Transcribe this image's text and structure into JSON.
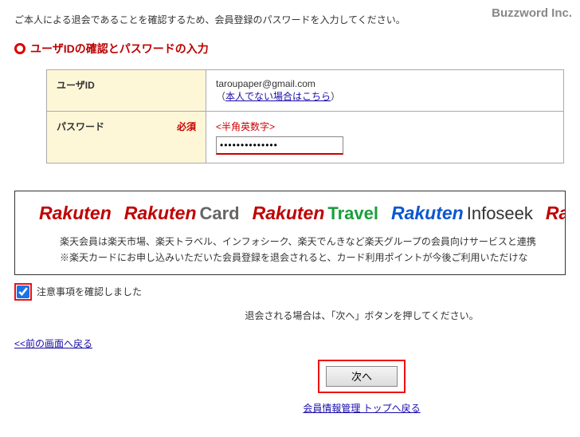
{
  "brand": "Buzzword Inc.",
  "intro": "ご本人による退会であることを確認するため、会員登録のパスワードを入力してください。",
  "section_title": "ユーザIDの確認とパスワードの入力",
  "form": {
    "userid_label": "ユーザID",
    "userid_value": "taroupaper@gmail.com",
    "userid_sublink_open": "（",
    "userid_sublink": "本人でない場合はこちら",
    "userid_sublink_close": "）",
    "password_label": "パスワード",
    "required": "必須",
    "password_hint": "<半角英数字>",
    "password_value": "••••••••••••••"
  },
  "logos": {
    "l1": "Rakuten",
    "l2": "Rakuten",
    "l2sub": "Card",
    "l3": "Rakuten",
    "l3sub": "Travel",
    "l4": "Rakuten",
    "l4sub": "Infoseek",
    "l5": "Ra"
  },
  "banner": {
    "line1": "楽天会員は楽天市場、楽天トラベル、インフォシーク、楽天でんきなど楽天グループの会員向けサービスと連携",
    "line2": "※楽天カードにお申し込みいただいた会員登録を退会されると、カード利用ポイントが今後ご利用いただけな"
  },
  "confirm_label": "注意事項を確認しました",
  "next_instruction": "退会される場合は、「次へ」ボタンを押してください。",
  "back_link": "<<前の画面へ戻る",
  "next_button": "次へ",
  "footer_link": "会員情報管理 トップへ戻る"
}
